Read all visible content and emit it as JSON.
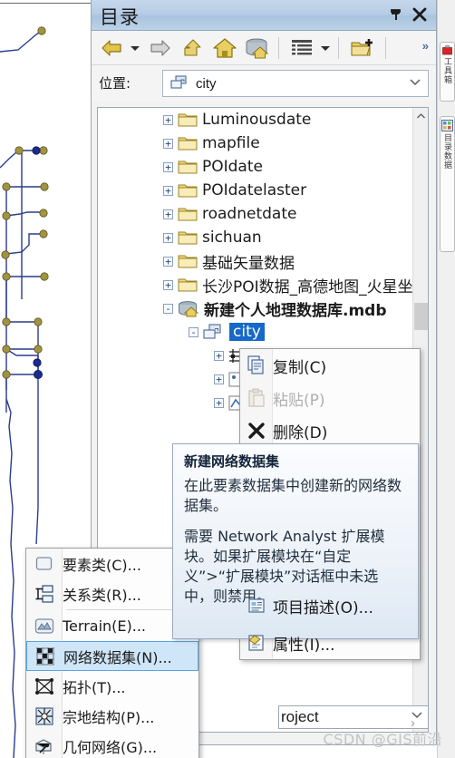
{
  "window": {
    "title": "目录",
    "pin_icon": "pin-icon",
    "close_icon": "close-icon"
  },
  "toolbar": {
    "items": [
      {
        "name": "back-button",
        "icon": "back-arrow-icon"
      },
      {
        "name": "back-dropdown",
        "icon": "chevron-down-icon"
      },
      {
        "name": "forward-button",
        "icon": "forward-arrow-icon"
      },
      {
        "name": "up-one-level-button",
        "icon": "up-arrow-icon"
      },
      {
        "name": "home-button",
        "icon": "home-icon"
      },
      {
        "name": "default-geodatabase-button",
        "icon": "database-home-icon"
      },
      {
        "name": "list-view-button",
        "icon": "grid-list-icon"
      },
      {
        "name": "list-view-dropdown",
        "icon": "chevron-down-icon"
      },
      {
        "name": "connect-folder-button",
        "icon": "add-folder-icon"
      }
    ],
    "overflow_label": "»"
  },
  "location": {
    "label": "位置:",
    "value": "city",
    "icon": "feature-dataset-icon",
    "caret_icon": "chevron-down-icon"
  },
  "tree": {
    "items": [
      {
        "label": "Luminousdate",
        "icon": "folder-icon",
        "expander": "+",
        "indent": 60,
        "bold": false,
        "selected": false
      },
      {
        "label": "mapfile",
        "icon": "folder-icon",
        "expander": "+",
        "indent": 60,
        "bold": false,
        "selected": false
      },
      {
        "label": "POIdate",
        "icon": "folder-icon",
        "expander": "+",
        "indent": 60,
        "bold": false,
        "selected": false
      },
      {
        "label": "POIdatelaster",
        "icon": "folder-icon",
        "expander": "+",
        "indent": 60,
        "bold": false,
        "selected": false
      },
      {
        "label": "roadnetdate",
        "icon": "folder-icon",
        "expander": "+",
        "indent": 60,
        "bold": false,
        "selected": false
      },
      {
        "label": "sichuan",
        "icon": "folder-icon",
        "expander": "+",
        "indent": 60,
        "bold": false,
        "selected": false
      },
      {
        "label": "基础矢量数据",
        "icon": "folder-icon",
        "expander": "+",
        "indent": 60,
        "bold": false,
        "selected": false
      },
      {
        "label": "长沙POI数据_高德地图_火星坐标",
        "icon": "folder-icon",
        "expander": "+",
        "indent": 60,
        "bold": false,
        "selected": false
      },
      {
        "label": "新建个人地理数据库.mdb",
        "icon": "personal-geodatabase-icon",
        "expander": "-",
        "indent": 60,
        "bold": true,
        "selected": false
      },
      {
        "label": "city",
        "icon": "feature-dataset-icon",
        "expander": "-",
        "indent": 88,
        "bold": false,
        "selected": true
      }
    ],
    "scroll": {
      "up_arrow": "scroll-up-icon",
      "down_arrow": "scroll-down-icon"
    }
  },
  "context_menu": {
    "items": [
      {
        "label": "复制(C)",
        "icon": "copy-icon",
        "disabled": false,
        "separator_after": false
      },
      {
        "label": "粘贴(P)",
        "icon": "paste-icon",
        "disabled": true,
        "separator_after": false
      },
      {
        "label": "删除(D)",
        "icon": "delete-x-icon",
        "disabled": false,
        "separator_after": true
      },
      {
        "label": "项目描述(O)...",
        "icon": "item-description-icon",
        "disabled": false,
        "separator_after": true
      },
      {
        "label": "属性(I)...",
        "icon": "properties-icon",
        "disabled": false,
        "separator_after": false
      }
    ]
  },
  "sub_menu": {
    "items": [
      {
        "label": "要素类(C)...",
        "icon": "feature-class-icon",
        "highlight": false,
        "separator_after": false
      },
      {
        "label": "关系类(R)...",
        "icon": "relationship-class-icon",
        "highlight": false,
        "separator_after": true
      },
      {
        "label": "Terrain(E)...",
        "icon": "terrain-icon",
        "highlight": false,
        "separator_after": false
      },
      {
        "label": "网络数据集(N)...",
        "icon": "network-dataset-icon",
        "highlight": true,
        "separator_after": false
      },
      {
        "label": "拓扑(T)...",
        "icon": "topology-icon",
        "highlight": false,
        "separator_after": false
      },
      {
        "label": "宗地结构(P)...",
        "icon": "parcel-fabric-icon",
        "highlight": false,
        "separator_after": false
      },
      {
        "label": "几何网络(G)...",
        "icon": "geometric-network-icon",
        "highlight": false,
        "separator_after": false
      }
    ]
  },
  "tooltip": {
    "title": "新建网络数据集",
    "paragraphs": [
      "在此要素数据集中创建新的网络数据集。",
      "需要 Network Analyst 扩展模块。如果扩展模块在“自定义”>“扩展模块”对话框中未选中，则禁用。"
    ]
  },
  "bottom_combo": {
    "value": "roject",
    "caret_icon": "chevron-down-icon"
  },
  "right_tabs": [
    {
      "label": "工具箱",
      "icon": "toolbox-icon"
    },
    {
      "label": "目录数据",
      "icon": "catalog-icon"
    }
  ],
  "watermark": {
    "text": "CSDN @GIS前沿",
    "chevron": "›"
  },
  "colors": {
    "selection_blue": "#1669c9",
    "highlight_blue": "#cfe6f9",
    "titlebar_blue": "#b7cde6",
    "folder_yellow": "#e8c96a",
    "map_line": "#2b3c8c",
    "map_node": "#a09440"
  },
  "chart_data": null
}
